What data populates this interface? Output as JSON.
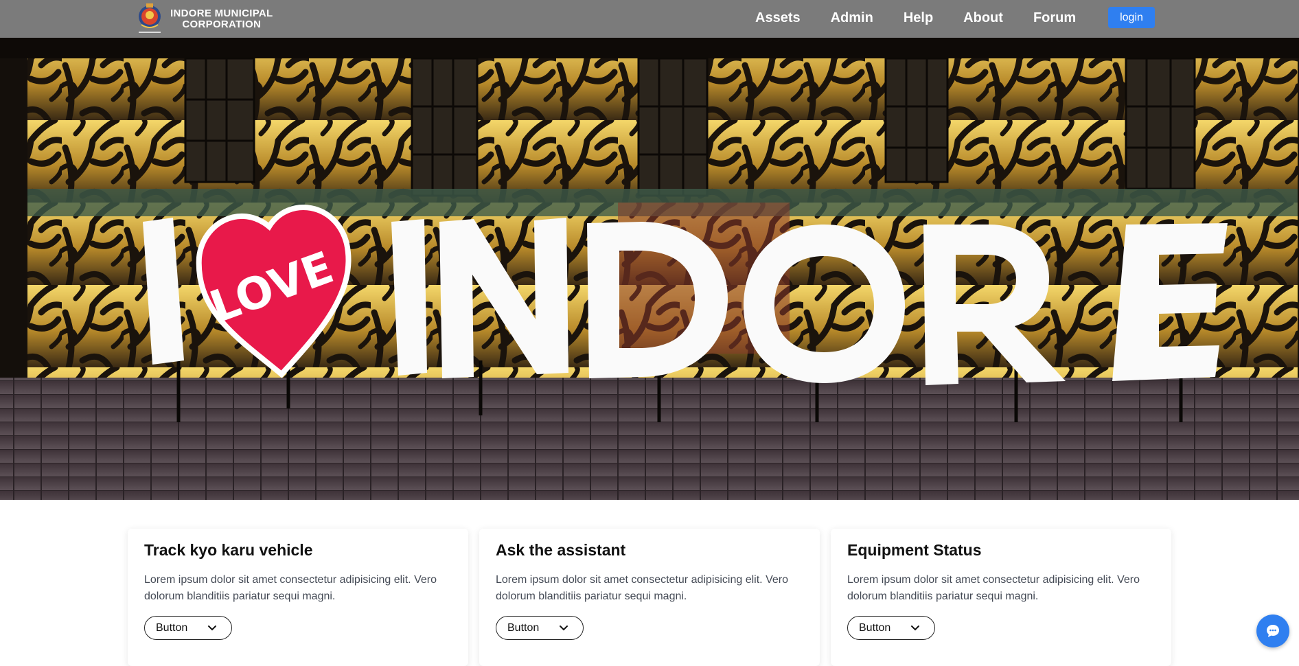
{
  "brand": {
    "line1": "INDORE MUNICIPAL",
    "line2": "CORPORATION",
    "logo_icon": "municipal-emblem-icon"
  },
  "nav": {
    "links": [
      "Assets",
      "Admin",
      "Help",
      "About",
      "Forum"
    ],
    "login_label": "login"
  },
  "hero": {
    "sign_text": "I ❤ INDORE",
    "heart_text": "LOVE",
    "heart_color": "#e8194a"
  },
  "cards": [
    {
      "title": "Track kyo karu vehicle",
      "text": "Lorem ipsum dolor sit amet consectetur adipisicing elit. Vero dolorum blanditiis pariatur sequi magni.",
      "button_label": "Button"
    },
    {
      "title": "Ask the assistant",
      "text": "Lorem ipsum dolor sit amet consectetur adipisicing elit. Vero dolorum blanditiis pariatur sequi magni.",
      "button_label": "Button"
    },
    {
      "title": "Equipment Status",
      "text": "Lorem ipsum dolor sit amet consectetur adipisicing elit. Vero dolorum blanditiis pariatur sequi magni.",
      "button_label": "Button"
    }
  ],
  "chat": {
    "icon": "chat-bubble-icon",
    "color": "#2f7ff0"
  },
  "colors": {
    "navbar": "#7b7b7b",
    "accent": "#2f7ff0"
  }
}
